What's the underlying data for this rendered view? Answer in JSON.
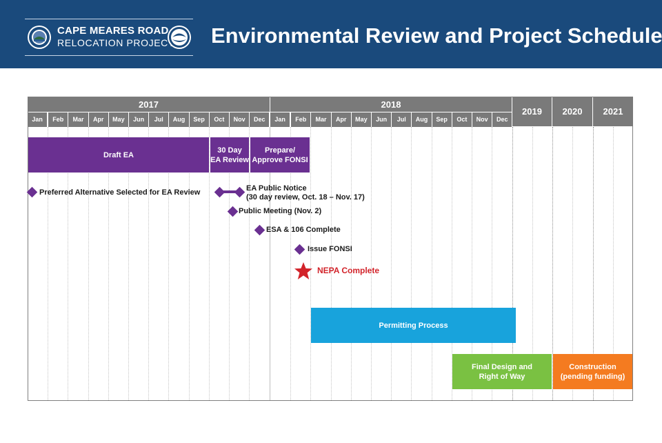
{
  "header": {
    "brand_line1": "CAPE MEARES ROAD",
    "brand_line2": "RELOCATION PROJECT",
    "title": "Environmental Review and Project Schedule",
    "colors": {
      "background": "#1a4a7c",
      "text": "#ffffff"
    },
    "logos": [
      "county-seal-icon",
      "dot-logo-icon"
    ]
  },
  "timeline": {
    "years": [
      {
        "label": "2017"
      },
      {
        "label": "2018"
      }
    ],
    "months_2017": [
      "Jan",
      "Feb",
      "Mar",
      "Apr",
      "May",
      "Jun",
      "Jul",
      "Aug",
      "Sep",
      "Oct",
      "Nov",
      "Dec"
    ],
    "months_2018": [
      "Jan",
      "Feb",
      "Mar",
      "Apr",
      "May",
      "Jun",
      "Jul",
      "Aug",
      "Sep",
      "Oct",
      "Nov",
      "Dec"
    ],
    "later_years": [
      "2019",
      "2020",
      "2021"
    ]
  },
  "bars": {
    "draft_ea": {
      "label": "Draft EA",
      "color": "#6a3091"
    },
    "review_30": {
      "line1": "30 Day",
      "line2": "EA Review",
      "color": "#6a3091"
    },
    "fonsi": {
      "line1": "Prepare/",
      "line2": "Approve FONSI",
      "color": "#6a3091"
    },
    "permitting": {
      "label": "Permitting Process",
      "color": "#18a3dc"
    },
    "final_design": {
      "line1": "Final Design and",
      "line2": "Right of Way",
      "color": "#7ac142"
    },
    "construction": {
      "line1": "Construction",
      "line2": "(pending funding)",
      "color": "#f47b20"
    }
  },
  "milestones": {
    "preferred_alt": "Preferred Alternative Selected for EA Review",
    "public_notice_1": "EA Public Notice",
    "public_notice_2": "(30 day review, Oct. 18 – Nov. 17)",
    "public_meeting": "Public Meeting (Nov. 2)",
    "esa": "ESA & 106 Complete",
    "issue_fonsi": "Issue FONSI",
    "nepa": "NEPA Complete",
    "diamond_color": "#6a3091",
    "nepa_color": "#d2232a"
  }
}
